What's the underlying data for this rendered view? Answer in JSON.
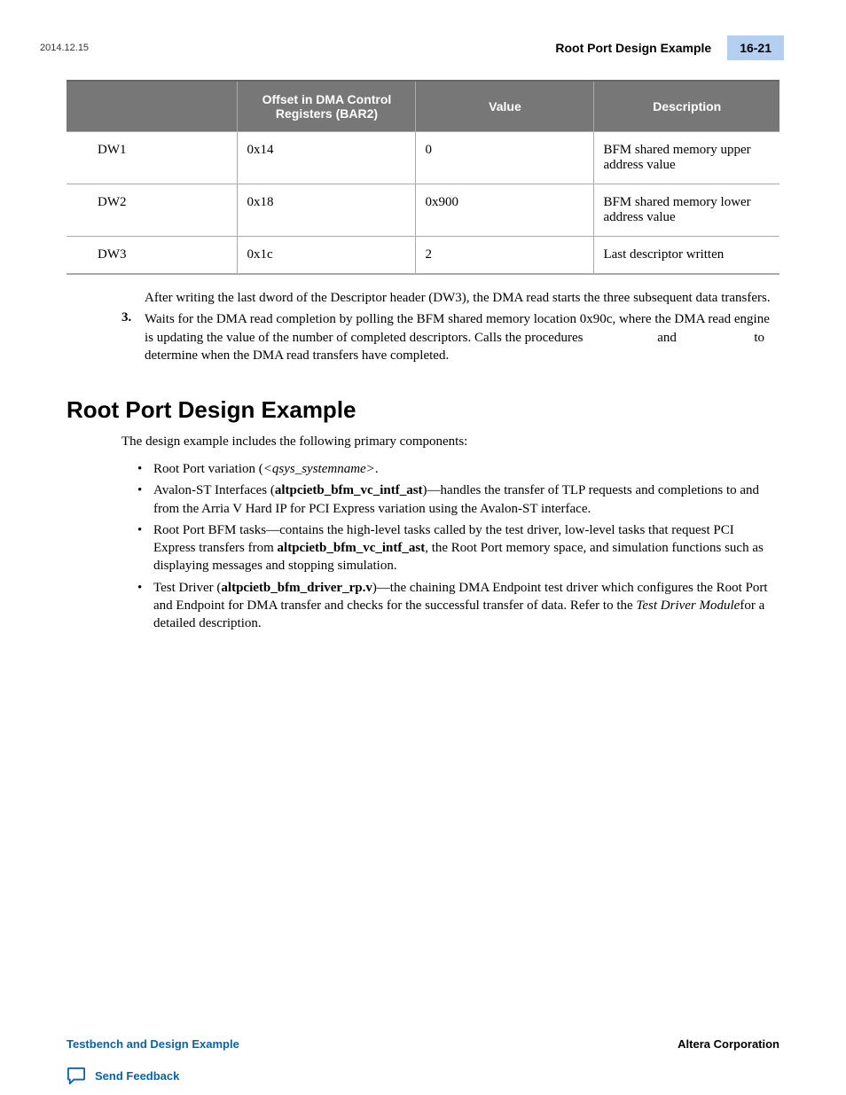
{
  "header": {
    "date": "2014.12.15",
    "title": "Root Port Design Example",
    "page_num": "16-21"
  },
  "table": {
    "headers": [
      "",
      "Offset in DMA Control Registers (BAR2)",
      "Value",
      "Description"
    ],
    "rows": [
      {
        "c0": "DW1",
        "c1": "0x14",
        "c2": "0",
        "c3": "BFM shared memory upper address value"
      },
      {
        "c0": "DW2",
        "c1": "0x18",
        "c2": "0x900",
        "c3": "BFM shared memory lower address value"
      },
      {
        "c0": "DW3",
        "c1": "0x1c",
        "c2": "2",
        "c3": "Last descriptor written"
      }
    ]
  },
  "body": {
    "para1": "After writing the last dword of the Descriptor header (DW3), the DMA read starts the three subsequent data transfers.",
    "step3_num": "3.",
    "step3_a": "Waits for the DMA read completion by polling the BFM shared memory location 0x90c, where the DMA read engine is updating the value of the number of completed descriptors. Calls the procedures",
    "step3_b": " and ",
    "step3_c": " to determine when the DMA read transfers have completed."
  },
  "section": {
    "heading": "Root Port Design Example",
    "intro": "The design example includes the following primary components:",
    "b1_a": "Root Port variation (",
    "b1_i": "<qsys_systemname>",
    "b1_b": ".",
    "b2_a": "Avalon-ST Interfaces (",
    "b2_bold": "altpcietb_bfm_vc_intf_ast",
    "b2_b": ")—handles the transfer of TLP requests and completions to and from the Arria V Hard IP for PCI Express variation using the Avalon‑ST interface.",
    "b3_a": "Root Port BFM tasks—contains the high-level tasks called by the test driver, low‑level tasks that request PCI Express transfers from ",
    "b3_bold": "altpcietb_bfm_vc_intf_ast",
    "b3_b": ", the Root Port memory space, and simulation functions such as displaying messages and stopping simulation.",
    "b4_a": "Test Driver (",
    "b4_bold": "altpcietb_bfm_driver_rp.v",
    "b4_b": ")—the chaining DMA Endpoint test driver which configures the Root Port and Endpoint for DMA transfer and checks for the successful transfer of data. Refer to the ",
    "b4_i": "Test Driver Module",
    "b4_c": "for a detailed description."
  },
  "footer": {
    "left": "Testbench and Design Example",
    "right": "Altera Corporation",
    "feedback": "Send Feedback"
  }
}
